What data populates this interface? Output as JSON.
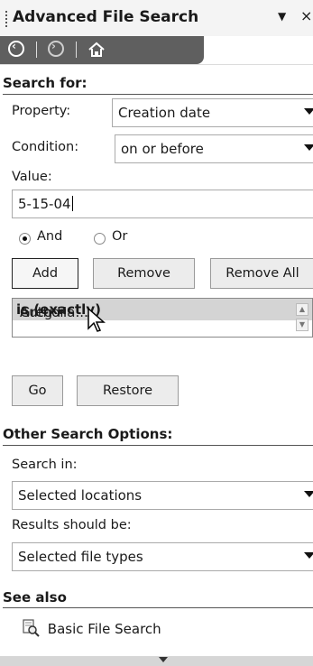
{
  "pane": {
    "title": "Advanced File Search"
  },
  "search_for": {
    "heading": "Search for:",
    "property_label": "Property:",
    "property_value": "Creation date",
    "condition_label": "Condition:",
    "condition_value": "on or before",
    "value_label": "Value:",
    "value_text": "5-15-04",
    "radio_and": "And",
    "radio_or": "Or",
    "selected_radio": "And",
    "add_label": "Add",
    "remove_label": "Remove",
    "remove_all_label": "Remove All",
    "criteria": [
      {
        "prefix": "Author ",
        "bold": "is (exactly)",
        "suffix": " Greg Ha..."
      }
    ],
    "go_label": "Go",
    "restore_label": "Restore"
  },
  "other_options": {
    "heading": "Other Search Options:",
    "search_in_label": "Search in:",
    "search_in_value": "Selected locations",
    "results_label": "Results should be:",
    "results_value": "Selected file types"
  },
  "see_also": {
    "heading": "See also",
    "basic_search_link": "Basic File Search"
  },
  "icons": {
    "back": "back-arrow-icon",
    "forward": "forward-arrow-icon",
    "home": "home-icon",
    "basic_search": "search-document-icon"
  }
}
